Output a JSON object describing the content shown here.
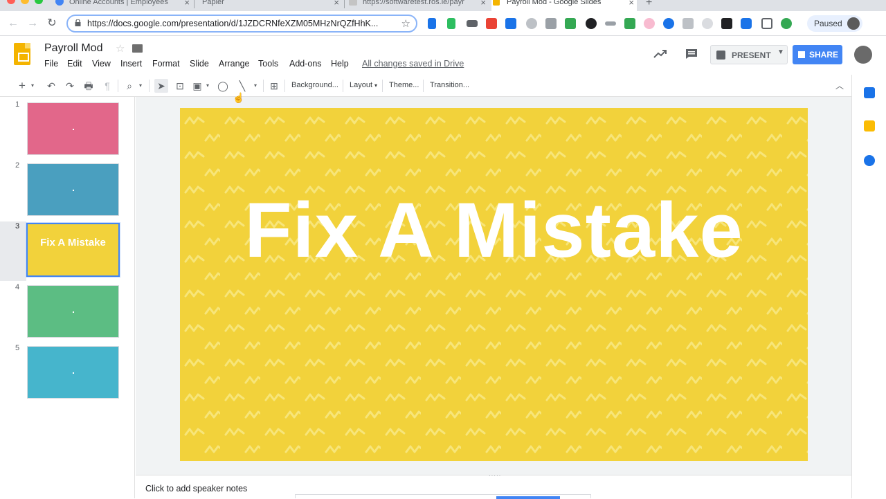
{
  "browser": {
    "tabs": [
      {
        "title": "Online Accounts | Employees",
        "active": false
      },
      {
        "title": "Papier",
        "active": false
      },
      {
        "title": "https://softwaretest.ros.ie/payr",
        "active": false
      },
      {
        "title": "Payroll Mod - Google Slides",
        "active": true
      }
    ],
    "url": "https://docs.google.com/presentation/d/1JZDCRNfeXZM05MHzNrQZfHhK...",
    "profile_label": "Paused"
  },
  "doc": {
    "title": "Payroll Mod",
    "menus": [
      "File",
      "Edit",
      "View",
      "Insert",
      "Format",
      "Slide",
      "Arrange",
      "Tools",
      "Add-ons",
      "Help"
    ],
    "saved_status": "All changes saved in Drive",
    "present_label": "PRESENT",
    "share_label": "SHARE"
  },
  "toolbar": {
    "background_label": "Background...",
    "layout_label": "Layout",
    "theme_label": "Theme...",
    "transition_label": "Transition..."
  },
  "filmstrip": {
    "slides": [
      {
        "number": "1",
        "color": "#e2678a",
        "text": ""
      },
      {
        "number": "2",
        "color": "#4a9fbf",
        "text": ""
      },
      {
        "number": "3",
        "color": "#f2d23b",
        "text": "Fix A Mistake"
      },
      {
        "number": "4",
        "color": "#5cbd83",
        "text": ""
      },
      {
        "number": "5",
        "color": "#46b5cc",
        "text": ""
      }
    ],
    "selected": "3"
  },
  "slide": {
    "title": "Fix A Mistake",
    "background_color": "#f2d23b"
  },
  "notes": {
    "placeholder": "Click to add speaker notes"
  },
  "colors": {
    "accent": "#4285f4",
    "slide_yellow": "#f2d23b"
  }
}
